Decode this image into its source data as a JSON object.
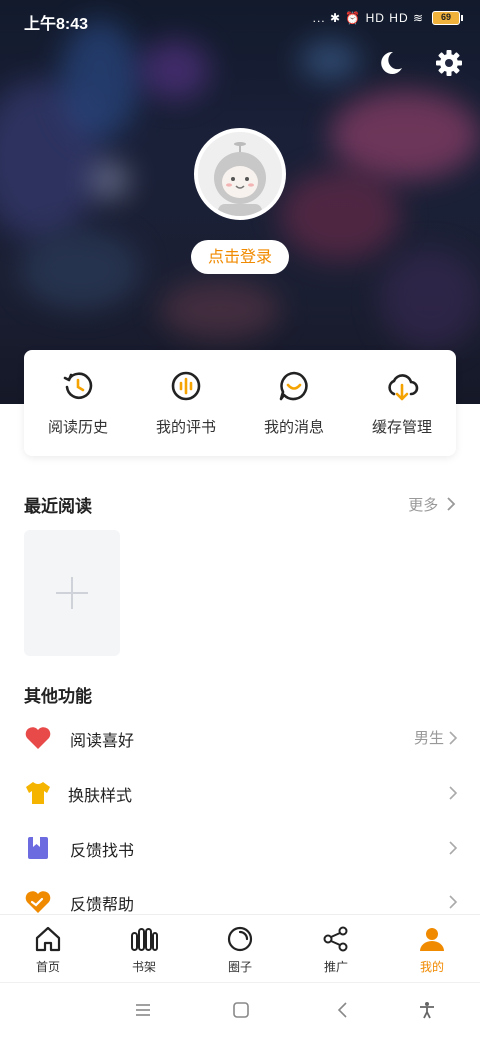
{
  "status_bar": {
    "time": "上午8:43",
    "battery": "69",
    "signals": "... ✱ ⏰ HD HD ≋"
  },
  "header": {
    "night_mode_icon": "moon-icon",
    "settings_icon": "gear-icon",
    "login_label": "点击登录"
  },
  "quick_actions": [
    {
      "label": "阅读历史",
      "icon": "history-icon"
    },
    {
      "label": "我的评书",
      "icon": "audio-review-icon"
    },
    {
      "label": "我的消息",
      "icon": "message-icon"
    },
    {
      "label": "缓存管理",
      "icon": "cloud-download-icon"
    }
  ],
  "recent": {
    "title": "最近阅读",
    "more_label": "更多"
  },
  "other": {
    "title": "其他功能",
    "items": [
      {
        "label": "阅读喜好",
        "value": "男生",
        "icon": "heart-icon"
      },
      {
        "label": "换肤样式",
        "value": "",
        "icon": "tshirt-icon"
      },
      {
        "label": "反馈找书",
        "value": "",
        "icon": "book-icon"
      },
      {
        "label": "反馈帮助",
        "value": "",
        "icon": "help-heart-icon"
      }
    ]
  },
  "bottom_nav": [
    {
      "label": "首页",
      "icon": "home-icon"
    },
    {
      "label": "书架",
      "icon": "bookshelf-icon"
    },
    {
      "label": "圈子",
      "icon": "circle-icon"
    },
    {
      "label": "推广",
      "icon": "share-icon"
    },
    {
      "label": "我的",
      "icon": "user-icon",
      "active": true
    }
  ],
  "colors": {
    "accent": "#f08a00",
    "quick_icon": "#f5a300"
  }
}
